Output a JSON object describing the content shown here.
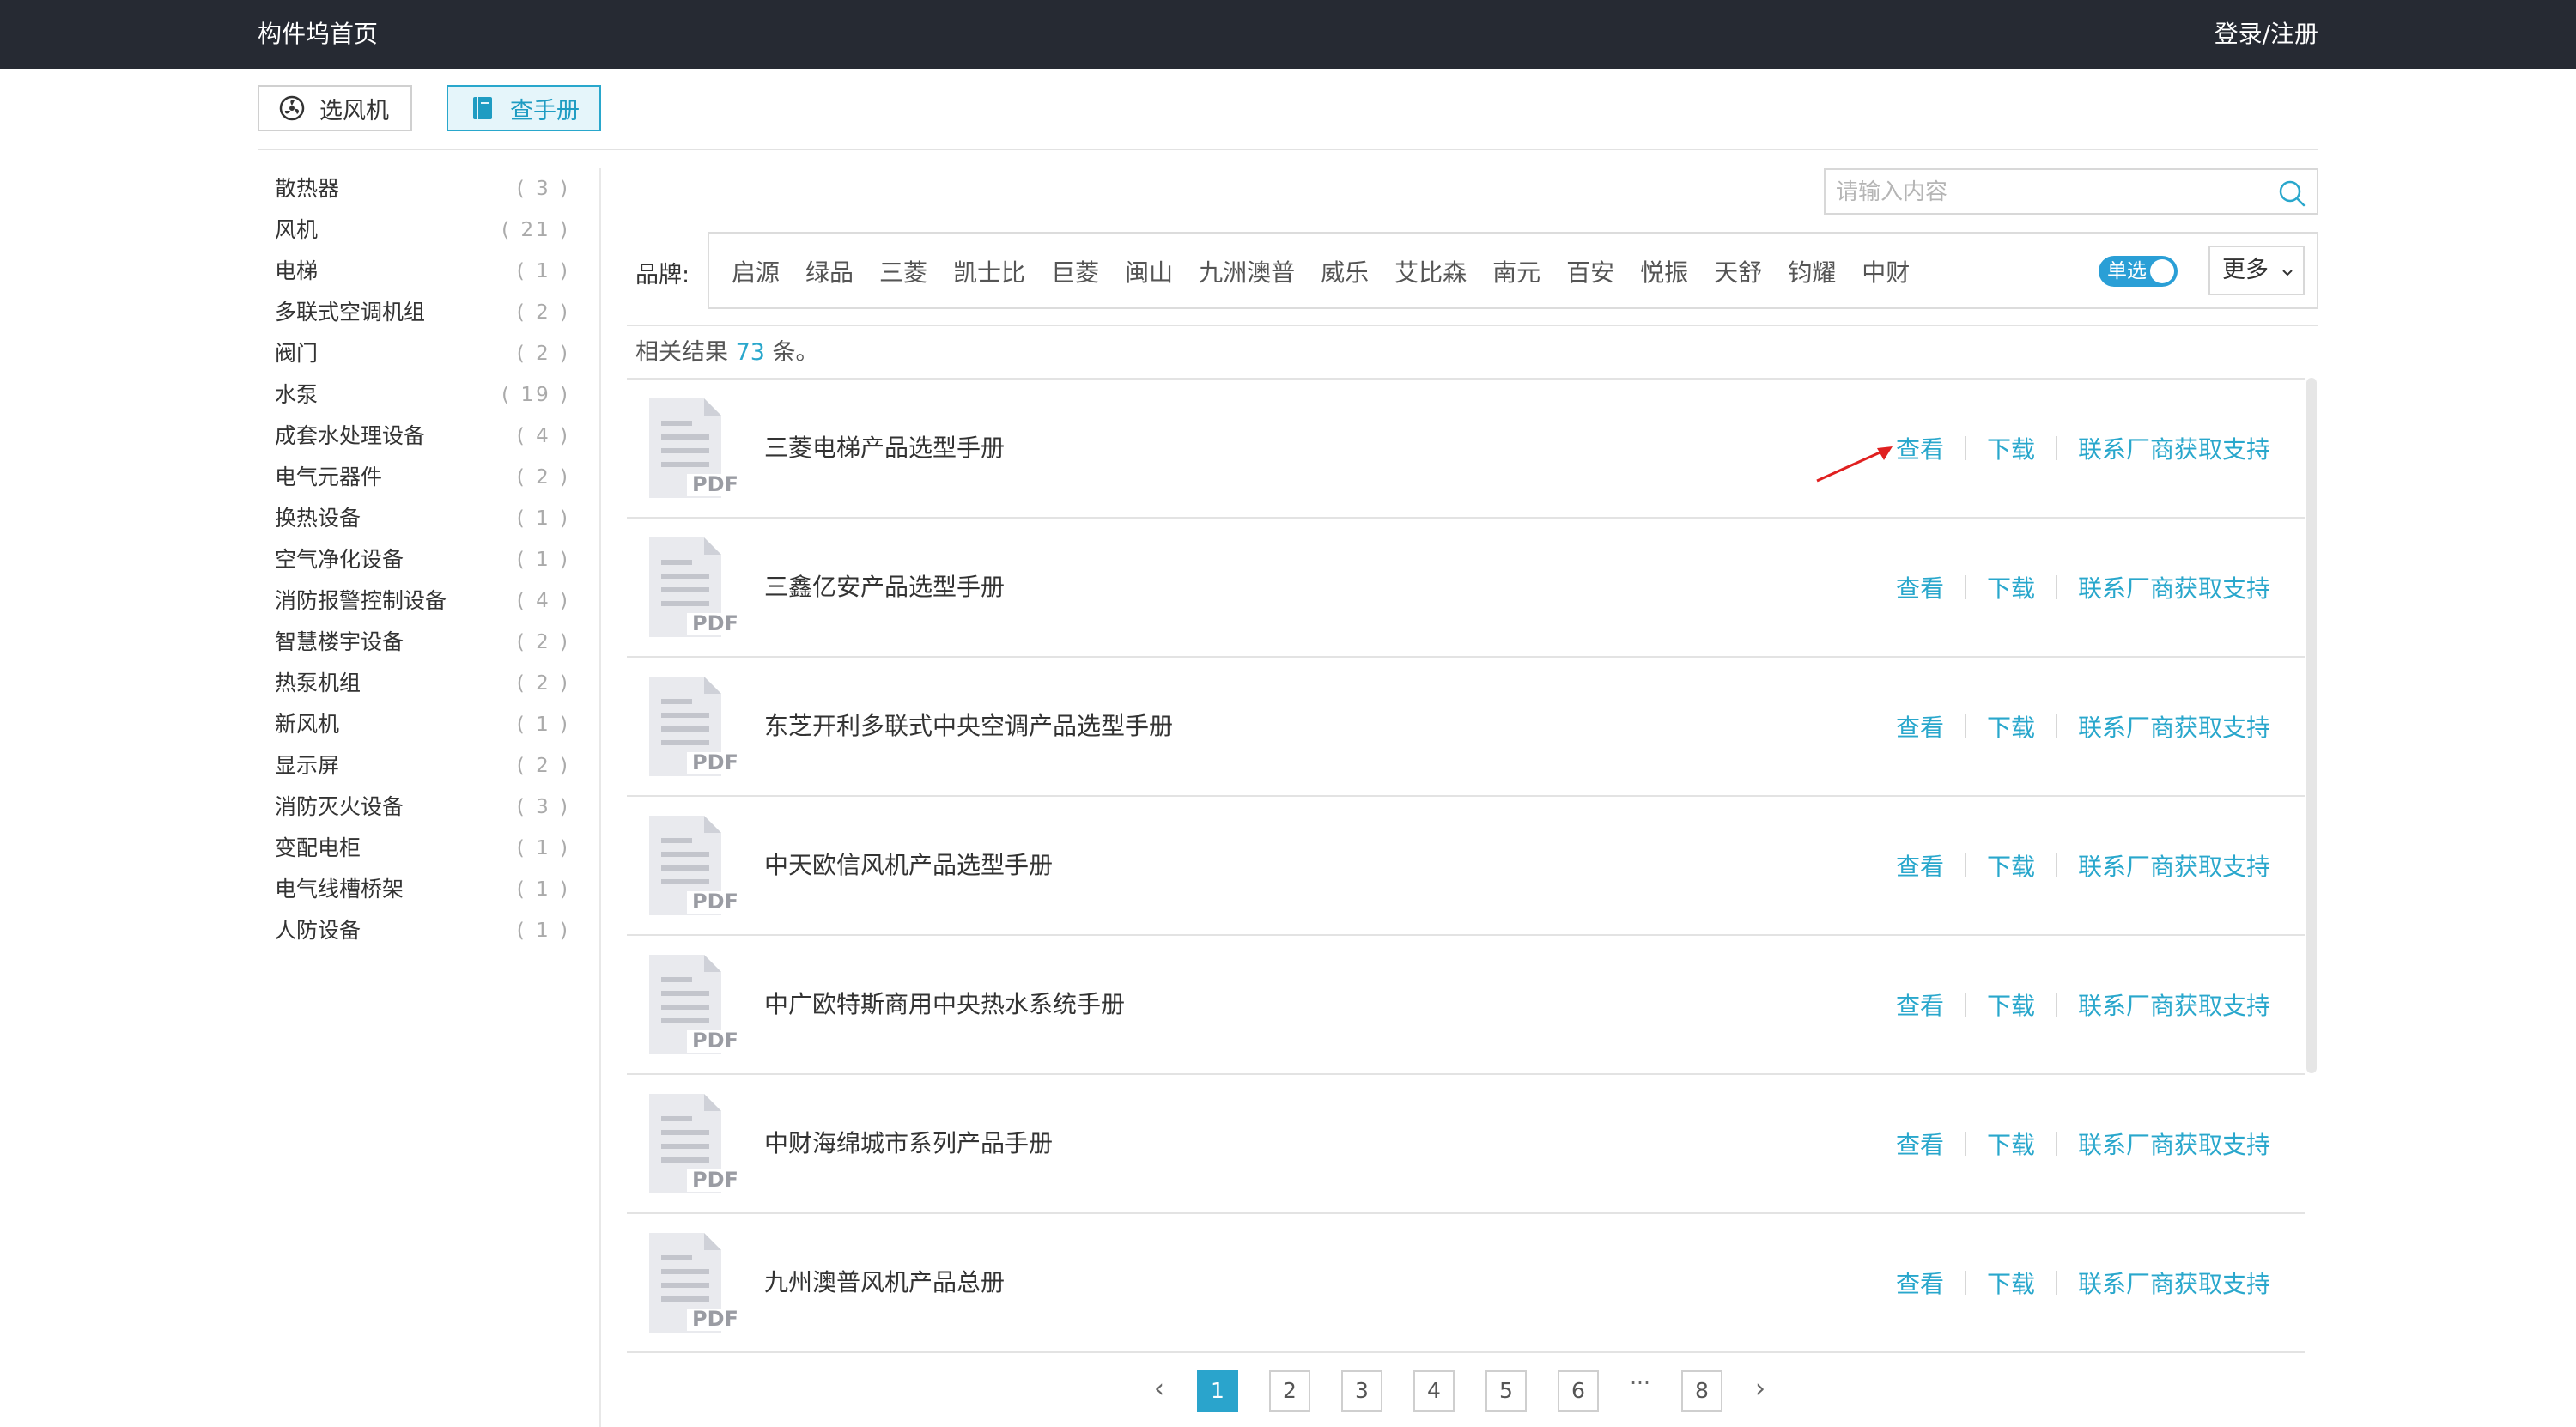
{
  "topbar": {
    "home_link": "构件坞首页",
    "login_link": "登录/注册"
  },
  "mode_tabs": [
    {
      "label": "选风机",
      "active": false,
      "icon": "fan-icon"
    },
    {
      "label": "查手册",
      "active": true,
      "icon": "book-icon"
    }
  ],
  "categories": [
    {
      "name": "散热器",
      "count": "( 3 )"
    },
    {
      "name": "风机",
      "count": "( 21 )"
    },
    {
      "name": "电梯",
      "count": "( 1 )"
    },
    {
      "name": "多联式空调机组",
      "count": "( 2 )"
    },
    {
      "name": "阀门",
      "count": "( 2 )"
    },
    {
      "name": "水泵",
      "count": "( 19 )"
    },
    {
      "name": "成套水处理设备",
      "count": "( 4 )"
    },
    {
      "name": "电气元器件",
      "count": "( 2 )"
    },
    {
      "name": "换热设备",
      "count": "( 1 )"
    },
    {
      "name": "空气净化设备",
      "count": "( 1 )"
    },
    {
      "name": "消防报警控制设备",
      "count": "( 4 )"
    },
    {
      "name": "智慧楼宇设备",
      "count": "( 2 )"
    },
    {
      "name": "热泵机组",
      "count": "( 2 )"
    },
    {
      "name": "新风机",
      "count": "( 1 )"
    },
    {
      "name": "显示屏",
      "count": "( 2 )"
    },
    {
      "name": "消防灭火设备",
      "count": "( 3 )"
    },
    {
      "name": "变配电柜",
      "count": "( 1 )"
    },
    {
      "name": "电气线槽桥架",
      "count": "( 1 )"
    },
    {
      "name": "人防设备",
      "count": "( 1 )"
    }
  ],
  "search": {
    "placeholder": "请输入内容",
    "value": ""
  },
  "brand_filter": {
    "label": "品牌:",
    "brands": [
      "启源",
      "绿品",
      "三菱",
      "凯士比",
      "巨菱",
      "闽山",
      "九洲澳普",
      "威乐",
      "艾比森",
      "南元",
      "百安",
      "悦振",
      "天舒",
      "钧耀",
      "中财"
    ],
    "single_select_label": "单选",
    "single_select_on": true,
    "more_label": "更多"
  },
  "results": {
    "prefix": "相关结果",
    "count": "73",
    "suffix": "条。"
  },
  "manuals": [
    {
      "title": "三菱电梯产品选型手册",
      "view": "查看",
      "download": "下载",
      "contact": "联系厂商获取支持"
    },
    {
      "title": "三鑫亿安产品选型手册",
      "view": "查看",
      "download": "下载",
      "contact": "联系厂商获取支持"
    },
    {
      "title": "东芝开利多联式中央空调产品选型手册",
      "view": "查看",
      "download": "下载",
      "contact": "联系厂商获取支持"
    },
    {
      "title": "中天欧信风机产品选型手册",
      "view": "查看",
      "download": "下载",
      "contact": "联系厂商获取支持"
    },
    {
      "title": "中广欧特斯商用中央热水系统手册",
      "view": "查看",
      "download": "下载",
      "contact": "联系厂商获取支持"
    },
    {
      "title": "中财海绵城市系列产品手册",
      "view": "查看",
      "download": "下载",
      "contact": "联系厂商获取支持"
    },
    {
      "title": "九州澳普风机产品总册",
      "view": "查看",
      "download": "下载",
      "contact": "联系厂商获取支持"
    }
  ],
  "file_badge": "PDF",
  "pagination": {
    "prev": "‹",
    "next": "›",
    "pages": [
      "1",
      "2",
      "3",
      "4",
      "5",
      "6"
    ],
    "ellipsis": "···",
    "last": "8",
    "current": "1"
  },
  "colors": {
    "accent": "#29a7cc",
    "topbar": "#262a33",
    "annotation_arrow": "#e02020"
  }
}
